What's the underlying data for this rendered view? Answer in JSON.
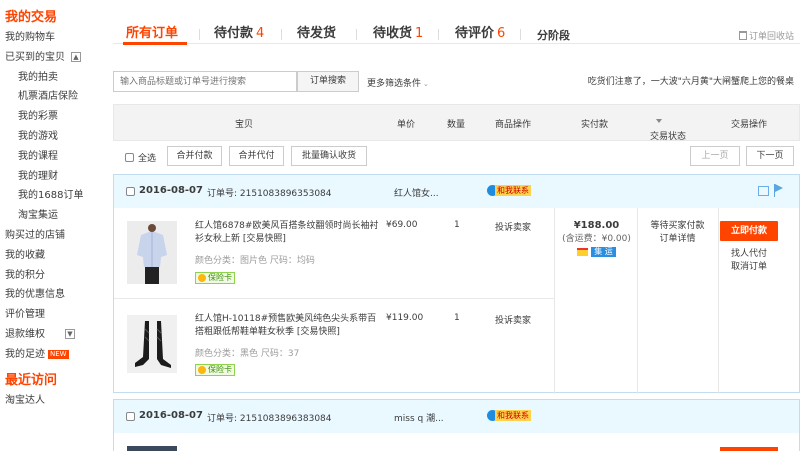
{
  "sidebar": {
    "my_trade": "我的交易",
    "items_top": [
      "我的购物车"
    ],
    "bought": "已买到的宝贝",
    "bought_toggle": "▲",
    "sub_items": [
      "我的拍卖",
      "机票酒店保险",
      "我的彩票",
      "我的游戏",
      "我的课程",
      "我的理财",
      "我的1688订单",
      "淘宝集运"
    ],
    "items_bottom": [
      "购买过的店铺",
      "我的收藏",
      "我的积分",
      "我的优惠信息",
      "评价管理"
    ],
    "refund": "退款维权",
    "refund_toggle": "▼",
    "footprint": "我的足迹",
    "new_badge": "NEW",
    "recent": "最近访问",
    "recent_items": [
      "淘宝达人"
    ]
  },
  "tabs": {
    "all": "所有订单",
    "unpaid": "待付款",
    "unpaid_count": "4",
    "unshipped": "待发货",
    "receiving": "待收货",
    "receiving_count": "1",
    "review": "待评价",
    "review_count": "6",
    "stage": "分阶段",
    "recycle": "订单回收站"
  },
  "search": {
    "placeholder": "输入商品标题或订单号进行搜索",
    "button": "订单搜索",
    "more": "更多筛选条件",
    "notice": "吃货们注意了，一大波\"六月黄\"大闸蟹爬上您的餐桌"
  },
  "table_header": {
    "item": "宝贝",
    "unit_price": "单价",
    "quantity": "数量",
    "item_ops": "商品操作",
    "paid": "实付款",
    "status": "交易状态",
    "trade_ops": "交易操作"
  },
  "bulk": {
    "select_all": "全选",
    "merge_pay": "合并付款",
    "merge_proxy": "合并代付",
    "batch_confirm": "批量确认收货",
    "prev": "上一页",
    "next": "下一页"
  },
  "orders": [
    {
      "date": "2016-08-07",
      "order_no_label": "订单号: 2151083896353084",
      "shop": "红人馆女...",
      "contact": "和我联系",
      "items": [
        {
          "title": "红人馆6878#欧美风百搭条纹翻领时尚长袖衬衫女秋上新 [交易快照]",
          "sku": "颜色分类：图片色  尺码：均码",
          "guard": "保险卡",
          "price": "¥69.00",
          "qty": "1",
          "complain": "投诉卖家"
        },
        {
          "title": "红人馆H-10118#预售欧美风纯色尖头系带百搭粗跟低帮鞋单鞋女秋季 [交易快照]",
          "sku": "颜色分类：黑色  尺码：37",
          "guard": "保险卡",
          "price": "¥119.00",
          "qty": "1",
          "complain": "投诉卖家"
        }
      ],
      "total": "¥188.00",
      "shipping": "(含运费：¥0.00)",
      "ship_tag": "集 运",
      "status": "等待买家付款",
      "detail": "订单详情",
      "pay": "立即付款",
      "proxy": "找人代付",
      "cancel": "取消订单"
    },
    {
      "date": "2016-08-07",
      "order_no_label": "订单号: 2151083896383084",
      "shop": "miss q 潮...",
      "contact": "和我联系"
    }
  ]
}
